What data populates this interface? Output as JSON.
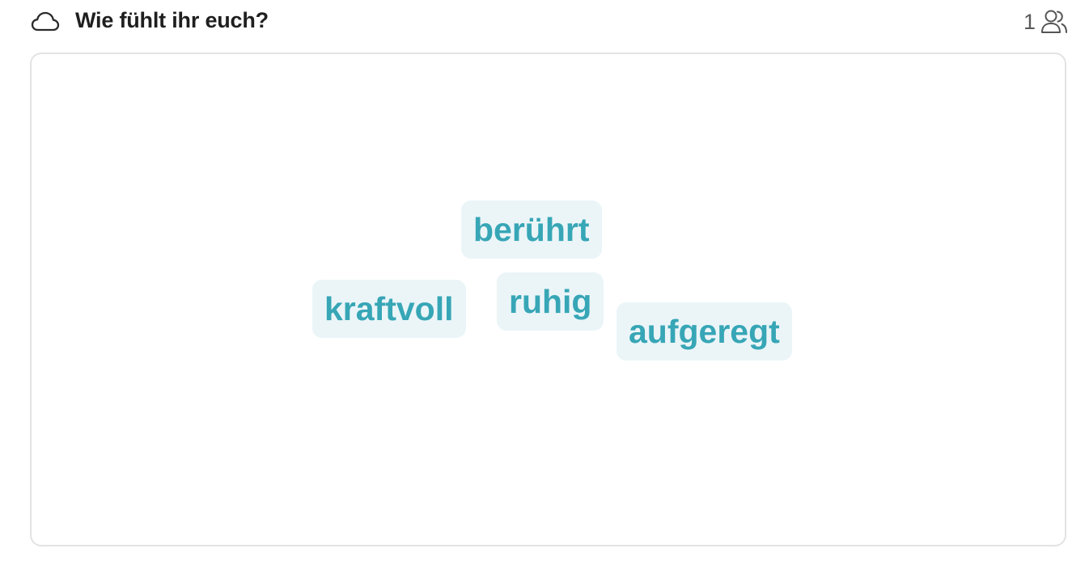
{
  "header": {
    "icon": "cloud-icon",
    "title": "Wie fühlt ihr euch?",
    "participant_count": "1",
    "participants_icon": "users-icon"
  },
  "wordcloud": {
    "accent_color": "#37a6b6",
    "chip_background": "#ebf5f8",
    "words": [
      {
        "text": "berührt"
      },
      {
        "text": "kraftvoll"
      },
      {
        "text": "ruhig"
      },
      {
        "text": "aufgeregt"
      }
    ]
  }
}
